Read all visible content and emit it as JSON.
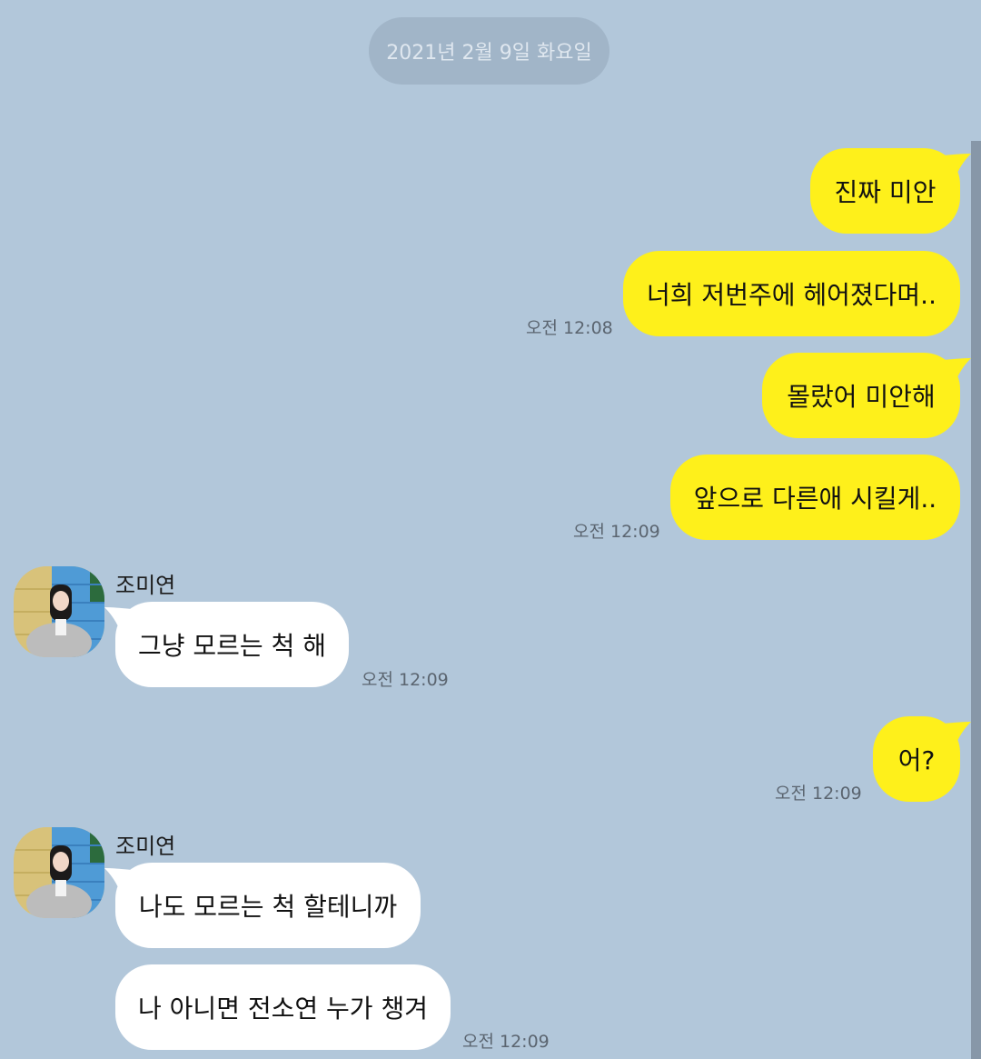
{
  "date_separator": "2021년 2월 9일 화요일",
  "messages_out_1": {
    "bubble_1": "진짜 미안",
    "bubble_2": "너희 저번주에 헤어졌다며..",
    "time": "오전 12:08"
  },
  "messages_out_2": {
    "bubble_1": "몰랐어 미안해",
    "bubble_2": "앞으로 다른애 시킬게..",
    "time": "오전 12:09"
  },
  "messages_in_1": {
    "sender": "조미연",
    "bubble_1": "그냥 모르는 척 해",
    "time": "오전 12:09"
  },
  "messages_out_3": {
    "bubble_1": "어?",
    "time": "오전 12:09"
  },
  "messages_in_2": {
    "sender": "조미연",
    "bubble_1": "나도 모르는 척 할테니까",
    "bubble_2": "나 아니면 전소연 누가 챙겨",
    "time": "오전 12:09"
  },
  "colors": {
    "background": "#b2c7da",
    "outgoing_bubble": "#fef01b",
    "incoming_bubble": "#ffffff"
  },
  "icons": {
    "avatar": "profile-photo"
  }
}
